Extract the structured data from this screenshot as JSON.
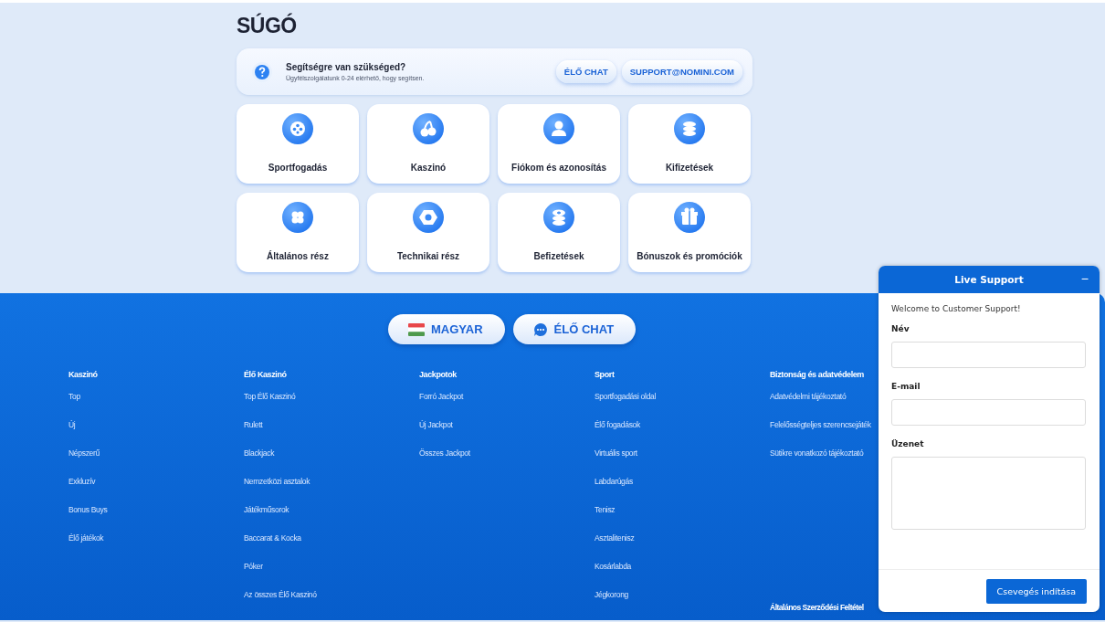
{
  "page_title": "SÚGÓ",
  "help_box": {
    "title": "Segítségre van szükséged?",
    "subtitle": "Ügyfélszolgálatunk 0-24 elérhető, hogy segítsen.",
    "buttons": [
      "ÉLŐ CHAT",
      "SUPPORT@NOMINI.COM"
    ]
  },
  "categories": [
    {
      "label": "Sportfogadás"
    },
    {
      "label": "Kaszinó"
    },
    {
      "label": "Fiókom és azonosítás"
    },
    {
      "label": "Kifizetések"
    },
    {
      "label": "Általános rész"
    },
    {
      "label": "Technikai rész"
    },
    {
      "label": "Befizetések"
    },
    {
      "label": "Bónuszok és promóciók"
    }
  ],
  "footer": {
    "language_button": "MAGYAR",
    "chat_button": "ÉLŐ CHAT",
    "columns": [
      {
        "heading": "Kaszinó",
        "links": [
          "Top",
          "Új",
          "Népszerű",
          "Exkluzív",
          "Bonus Buys",
          "Élő játékok"
        ]
      },
      {
        "heading": "Élő Kaszinó",
        "links": [
          "Top Élő Kaszinó",
          "Rulett",
          "Blackjack",
          "Nemzetközi asztalok",
          "Játékműsorok",
          "Baccarat & Kocka",
          "Póker",
          "Az összes Élő Kaszinó"
        ]
      },
      {
        "heading": "Jackpotok",
        "links": [
          "Forró Jackpot",
          "Új Jackpot",
          "Összes Jackpot"
        ]
      },
      {
        "heading": "Sport",
        "links": [
          "Sportfogadási oldal",
          "Élő fogadások",
          "Virtuális sport",
          "Labdarúgás",
          "Tenisz",
          "Asztalitenisz",
          "Kosárlabda",
          "Jégkorong"
        ]
      },
      {
        "heading": "Biztonság és adatvédelem",
        "links": [
          "Adatvédelmi tájékoztató",
          "Felelősségteljes szerencsejáték",
          "Sütikre vonatkozó tájékoztató"
        ],
        "second_heading": "Általános Szerződési Feltétel"
      }
    ]
  },
  "live_support": {
    "title": "Live Support",
    "minimize": "−",
    "welcome": "Welcome to Customer Support!",
    "fields": [
      {
        "label": "Név",
        "kind": "input"
      },
      {
        "label": "E-mail",
        "kind": "input"
      },
      {
        "label": "Üzenet",
        "kind": "textarea"
      }
    ],
    "submit": "Csevegés indítása"
  }
}
